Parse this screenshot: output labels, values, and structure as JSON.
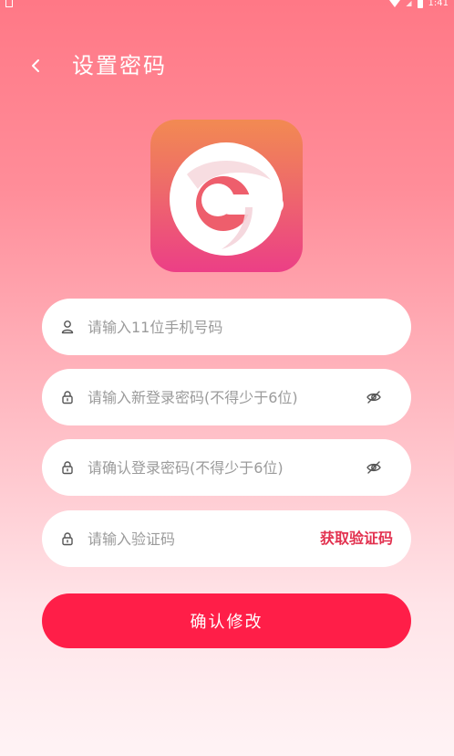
{
  "status_bar": {
    "time": "1:41"
  },
  "header": {
    "title": "设置密码",
    "back_icon": "chevron-left-icon"
  },
  "logo": {
    "icon": "app-logo-g"
  },
  "form": {
    "phone": {
      "icon": "user-icon",
      "placeholder": "请输入11位手机号码",
      "value": ""
    },
    "new_password": {
      "icon": "lock-icon",
      "placeholder": "请输入新登录密码(不得少于6位)",
      "value": "",
      "toggle_icon": "eye-off-icon"
    },
    "confirm_password": {
      "icon": "lock-icon",
      "placeholder": "请确认登录密码(不得少于6位)",
      "value": "",
      "toggle_icon": "eye-off-icon"
    },
    "code": {
      "icon": "lock-icon",
      "placeholder": "请输入验证码",
      "value": "",
      "get_code_label": "获取验证码"
    },
    "submit_label": "确认修改"
  },
  "colors": {
    "accent": "#ff1e48",
    "code_link": "#e2314f",
    "background_top": "#ff7886",
    "background_bottom": "#fff3f5"
  }
}
